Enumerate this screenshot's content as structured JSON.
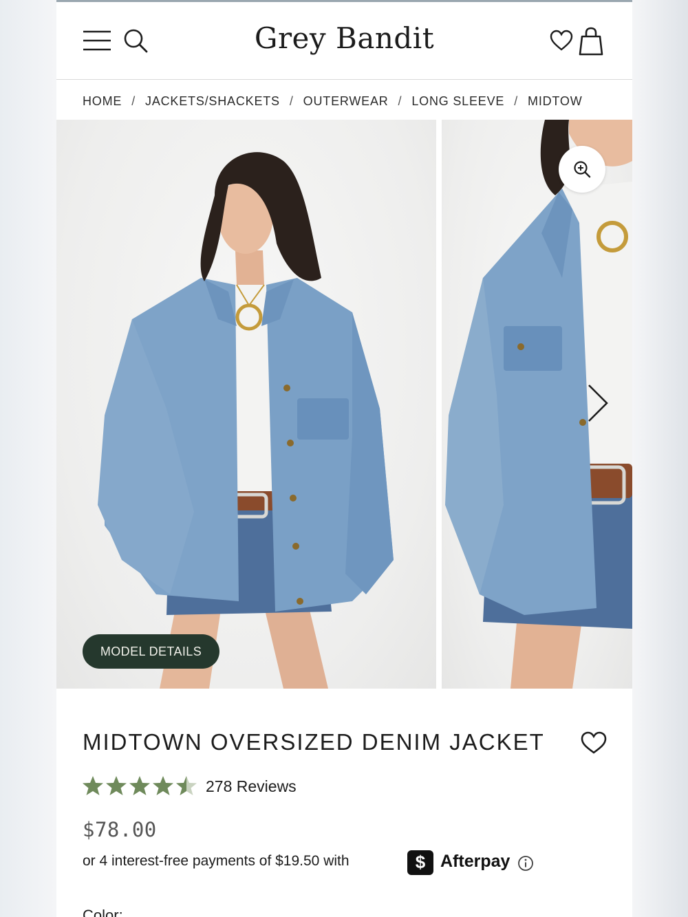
{
  "header": {
    "brand": "Grey Bandit",
    "icons": [
      "menu-icon",
      "search-icon",
      "heart-icon",
      "bag-icon"
    ]
  },
  "breadcrumb": [
    "HOME",
    "JACKETS/SHACKETS",
    "OUTERWEAR",
    "LONG SLEEVE",
    "MIDTOW"
  ],
  "breadcrumb_separator": "/",
  "gallery": {
    "model_details_label": "MODEL DETAILS",
    "zoom_icon": "zoom-in-icon",
    "next_icon": "chevron-right-icon"
  },
  "product": {
    "title": "MIDTOWN OVERSIZED DENIM JACKET",
    "rating": 4.5,
    "reviews_label": "278 Reviews",
    "price": "$78.00",
    "installments_text": "or 4 interest-free payments of $19.50 with",
    "afterpay_badge": "$",
    "afterpay_label": "Afterpay",
    "color_label": "Color:"
  },
  "colors": {
    "star": "#6f8a5b",
    "model_button_bg": "#25382d",
    "denim": "#7ea3c8"
  }
}
